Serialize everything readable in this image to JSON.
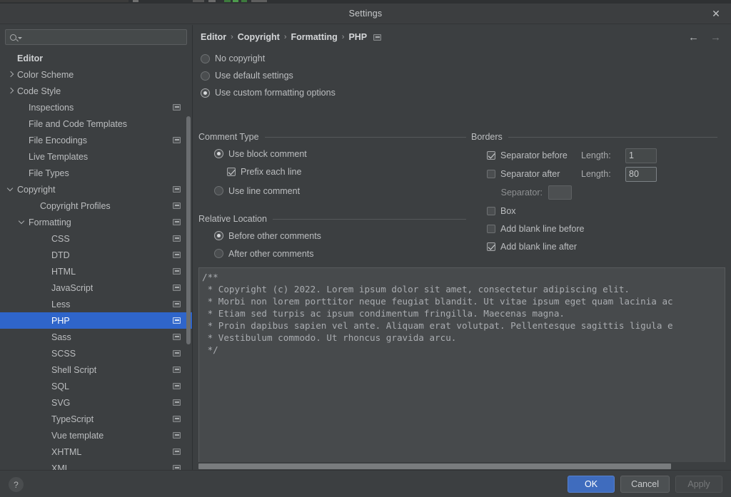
{
  "window": {
    "title": "Settings",
    "close_icon": "close-icon"
  },
  "sidebar": {
    "search": {
      "placeholder": "",
      "value": "",
      "icon": "search-icon"
    },
    "items": [
      {
        "label": "Editor",
        "indent": 0,
        "arrow": "none",
        "bold": true,
        "module": false,
        "selected": false
      },
      {
        "label": "Color Scheme",
        "indent": 0,
        "arrow": "right",
        "bold": false,
        "module": false,
        "selected": false
      },
      {
        "label": "Code Style",
        "indent": 0,
        "arrow": "right",
        "bold": false,
        "module": false,
        "selected": false
      },
      {
        "label": "Inspections",
        "indent": 1,
        "arrow": "none",
        "bold": false,
        "module": true,
        "selected": false
      },
      {
        "label": "File and Code Templates",
        "indent": 1,
        "arrow": "none",
        "bold": false,
        "module": false,
        "selected": false
      },
      {
        "label": "File Encodings",
        "indent": 1,
        "arrow": "none",
        "bold": false,
        "module": true,
        "selected": false
      },
      {
        "label": "Live Templates",
        "indent": 1,
        "arrow": "none",
        "bold": false,
        "module": false,
        "selected": false
      },
      {
        "label": "File Types",
        "indent": 1,
        "arrow": "none",
        "bold": false,
        "module": false,
        "selected": false
      },
      {
        "label": "Copyright",
        "indent": 0,
        "arrow": "down",
        "bold": false,
        "module": true,
        "selected": false
      },
      {
        "label": "Copyright Profiles",
        "indent": 2,
        "arrow": "none",
        "bold": false,
        "module": true,
        "selected": false
      },
      {
        "label": "Formatting",
        "indent": 1,
        "arrow": "down",
        "bold": false,
        "module": true,
        "selected": false
      },
      {
        "label": "CSS",
        "indent": 3,
        "arrow": "none",
        "bold": false,
        "module": true,
        "selected": false
      },
      {
        "label": "DTD",
        "indent": 3,
        "arrow": "none",
        "bold": false,
        "module": true,
        "selected": false
      },
      {
        "label": "HTML",
        "indent": 3,
        "arrow": "none",
        "bold": false,
        "module": true,
        "selected": false
      },
      {
        "label": "JavaScript",
        "indent": 3,
        "arrow": "none",
        "bold": false,
        "module": true,
        "selected": false
      },
      {
        "label": "Less",
        "indent": 3,
        "arrow": "none",
        "bold": false,
        "module": true,
        "selected": false
      },
      {
        "label": "PHP",
        "indent": 3,
        "arrow": "none",
        "bold": false,
        "module": true,
        "selected": true
      },
      {
        "label": "Sass",
        "indent": 3,
        "arrow": "none",
        "bold": false,
        "module": true,
        "selected": false
      },
      {
        "label": "SCSS",
        "indent": 3,
        "arrow": "none",
        "bold": false,
        "module": true,
        "selected": false
      },
      {
        "label": "Shell Script",
        "indent": 3,
        "arrow": "none",
        "bold": false,
        "module": true,
        "selected": false
      },
      {
        "label": "SQL",
        "indent": 3,
        "arrow": "none",
        "bold": false,
        "module": true,
        "selected": false
      },
      {
        "label": "SVG",
        "indent": 3,
        "arrow": "none",
        "bold": false,
        "module": true,
        "selected": false
      },
      {
        "label": "TypeScript",
        "indent": 3,
        "arrow": "none",
        "bold": false,
        "module": true,
        "selected": false
      },
      {
        "label": "Vue template",
        "indent": 3,
        "arrow": "none",
        "bold": false,
        "module": true,
        "selected": false
      },
      {
        "label": "XHTML",
        "indent": 3,
        "arrow": "none",
        "bold": false,
        "module": true,
        "selected": false
      },
      {
        "label": "XML",
        "indent": 3,
        "arrow": "none",
        "bold": false,
        "module": true,
        "selected": false
      }
    ]
  },
  "main": {
    "breadcrumb": [
      "Editor",
      "Copyright",
      "Formatting",
      "PHP"
    ],
    "breadcrumb_separator": "›",
    "nav": {
      "back_icon": "arrow-left-icon",
      "forward_icon": "arrow-right-icon"
    },
    "copyright_mode": [
      {
        "label": "No copyright",
        "selected": false
      },
      {
        "label": "Use default settings",
        "selected": false
      },
      {
        "label": "Use custom formatting options",
        "selected": true
      }
    ],
    "comment_type": {
      "title": "Comment Type",
      "options": [
        {
          "label": "Use block comment",
          "selected": true
        },
        {
          "label": "Use line comment",
          "selected": false
        }
      ],
      "prefix_each_line": {
        "label": "Prefix each line",
        "checked": true
      }
    },
    "relative_location": {
      "title": "Relative Location",
      "options": [
        {
          "label": "Before other comments",
          "selected": true
        },
        {
          "label": "After other comments",
          "selected": false
        }
      ]
    },
    "borders": {
      "title": "Borders",
      "separator_before": {
        "label": "Separator before",
        "checked": true,
        "length_label": "Length:",
        "length_value": "1"
      },
      "separator_after": {
        "label": "Separator after",
        "checked": false,
        "length_label": "Length:",
        "length_value": "80"
      },
      "separator": {
        "label": "Separator:",
        "value": ""
      },
      "box": {
        "label": "Box",
        "checked": false
      },
      "add_blank_before": {
        "label": "Add blank line before",
        "checked": false
      },
      "add_blank_after": {
        "label": "Add blank line after",
        "checked": true
      }
    },
    "preview": "/**\n * Copyright (c) 2022. Lorem ipsum dolor sit amet, consectetur adipiscing elit.\n * Morbi non lorem porttitor neque feugiat blandit. Ut vitae ipsum eget quam lacinia ac\n * Etiam sed turpis ac ipsum condimentum fringilla. Maecenas magna.\n * Proin dapibus sapien vel ante. Aliquam erat volutpat. Pellentesque sagittis ligula e\n * Vestibulum commodo. Ut rhoncus gravida arcu.\n */"
  },
  "footer": {
    "help_label": "?",
    "ok": "OK",
    "cancel": "Cancel",
    "apply": "Apply"
  },
  "colors": {
    "accent": "#2f65ca",
    "panel": "#3c3f41",
    "preview_bg": "#474a4c",
    "primary_button": "#3f6cbe"
  }
}
